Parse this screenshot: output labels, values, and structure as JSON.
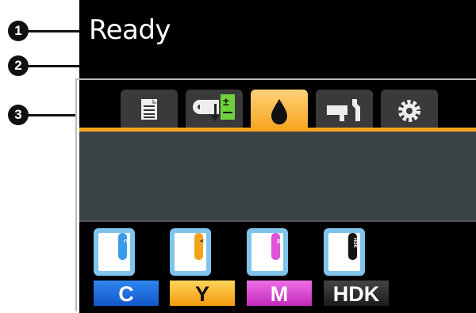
{
  "status": {
    "text": "Ready"
  },
  "callouts": [
    "1",
    "2",
    "3"
  ],
  "tabs": [
    {
      "icon": "print-queue-icon"
    },
    {
      "icon": "paper-feed-adjust-icon"
    },
    {
      "icon": "ink-drop-icon",
      "active": true
    },
    {
      "icon": "maintenance-icon"
    },
    {
      "icon": "gear-icon"
    }
  ],
  "ink": [
    {
      "label": "C",
      "mark": "C",
      "color": "#3b9be8",
      "label_bg": "#1c6fe0"
    },
    {
      "label": "Y",
      "mark": "Y",
      "color": "#f2a31b",
      "label_bg": "#f6b51c"
    },
    {
      "label": "M",
      "mark": "M",
      "color": "#e052d9",
      "label_bg": "#d83fcf"
    },
    {
      "label": "HDK",
      "mark": "HDK",
      "color": "#111111",
      "label_bg": "#2b2b2b"
    }
  ],
  "colors": {
    "accent": "#f7a51f",
    "panel": "#3b4347"
  }
}
